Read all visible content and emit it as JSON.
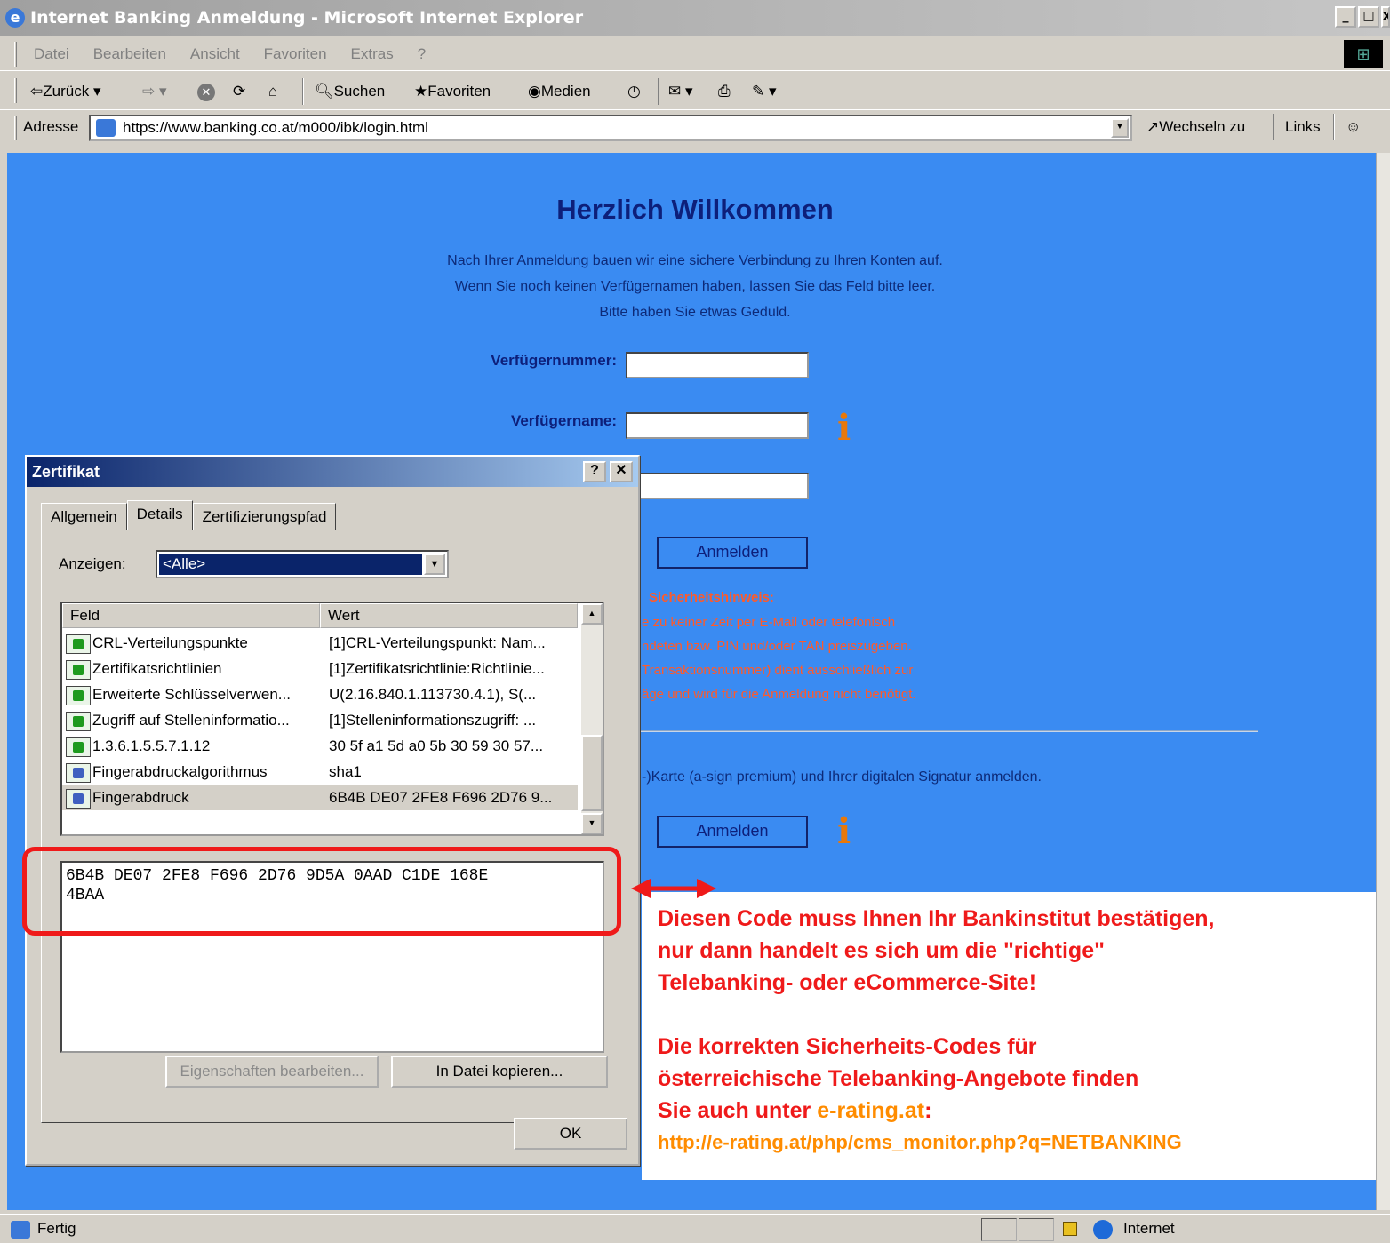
{
  "window": {
    "title": "Internet Banking Anmeldung - Microsoft Internet Explorer"
  },
  "menu": [
    "Datei",
    "Bearbeiten",
    "Ansicht",
    "Favoriten",
    "Extras",
    "?"
  ],
  "toolbar": {
    "back": "Zurück",
    "search": "Suchen",
    "favorites": "Favoriten",
    "media": "Medien"
  },
  "address": {
    "label": "Adresse",
    "url": "https://www.banking.co.at/m000/ibk/login.html",
    "go": "Wechseln zu",
    "links": "Links"
  },
  "page": {
    "title": "Herzlich Willkommen",
    "intro": [
      "Nach Ihrer Anmeldung bauen wir eine sichere Verbindung zu Ihren Konten auf.",
      "Wenn Sie noch keinen Verfügernamen haben, lassen Sie das Feld bitte leer.",
      "Bitte haben Sie etwas Geduld."
    ],
    "field1_label": "Verfügernummer:",
    "field2_label": "Verfügername:",
    "login_button": "Anmelden",
    "security_heading": "Sicherheitshinweis:",
    "security_lines": [
      "e zu keiner Zeit per E-Mail oder telefonisch",
      "ndeten bzw. PIN und/oder TAN preiszugeben.",
      "Transaktionsnummer) dient ausschließlich zur",
      "äge und wird für die Anmeldung nicht benötigt."
    ],
    "card_text": "-)Karte (a-sign premium) und Ihrer digitalen Signatur anmelden.",
    "login_button2": "Anmelden"
  },
  "dialog": {
    "title": "Zertifikat",
    "help_btn": "?",
    "close_btn": "✕",
    "tabs": [
      "Allgemein",
      "Details",
      "Zertifizierungspfad"
    ],
    "show_label": "Anzeigen:",
    "show_value": "<Alle>",
    "columns": [
      "Feld",
      "Wert"
    ],
    "rows": [
      {
        "feld": "CRL-Verteilungspunkte",
        "wert": "[1]CRL-Verteilungspunkt: Nam...",
        "icon": "extension-icon"
      },
      {
        "feld": "Zertifikatsrichtlinien",
        "wert": "[1]Zertifikatsrichtlinie:Richtlinie...",
        "icon": "extension-icon"
      },
      {
        "feld": "Erweiterte Schlüsselverwen...",
        "wert": "U(2.16.840.1.113730.4.1), S(...",
        "icon": "extension-icon"
      },
      {
        "feld": "Zugriff auf Stelleninformatio...",
        "wert": "[1]Stelleninformationszugriff: ...",
        "icon": "extension-icon"
      },
      {
        "feld": "1.3.6.1.5.5.7.1.12",
        "wert": "30 5f a1 5d a0 5b 30 59 30 57...",
        "icon": "extension-icon"
      },
      {
        "feld": "Fingerabdruckalgorithmus",
        "wert": "sha1",
        "icon": "property-icon"
      },
      {
        "feld": "Fingerabdruck",
        "wert": "6B4B DE07 2FE8 F696 2D76 9...",
        "icon": "property-icon"
      }
    ],
    "code_line1": "6B4B DE07 2FE8 F696 2D76 9D5A 0AAD C1DE 168E",
    "code_line2": "4BAA",
    "edit_btn": "Eigenschaften bearbeiten...",
    "copy_btn": "In Datei kopieren...",
    "ok_btn": "OK"
  },
  "annotation": {
    "line1": "Diesen Code muss Ihnen Ihr Bankinstitut bestätigen,",
    "line2": "nur dann  handelt es sich um die \"richtige\"",
    "line3": "Telebanking- oder eCommerce-Site!",
    "line4": "Die korrekten Sicherheits-Codes für",
    "line5": "österreichische Telebanking-Angebote finden",
    "line6_prefix": "Sie auch unter ",
    "line6_link": "e-rating.at",
    "line6_suffix": ":",
    "url": "http://e-rating.at/php/cms_monitor.php?q=NETBANKING"
  },
  "status": {
    "text": "Fertig",
    "zone": "Internet"
  }
}
